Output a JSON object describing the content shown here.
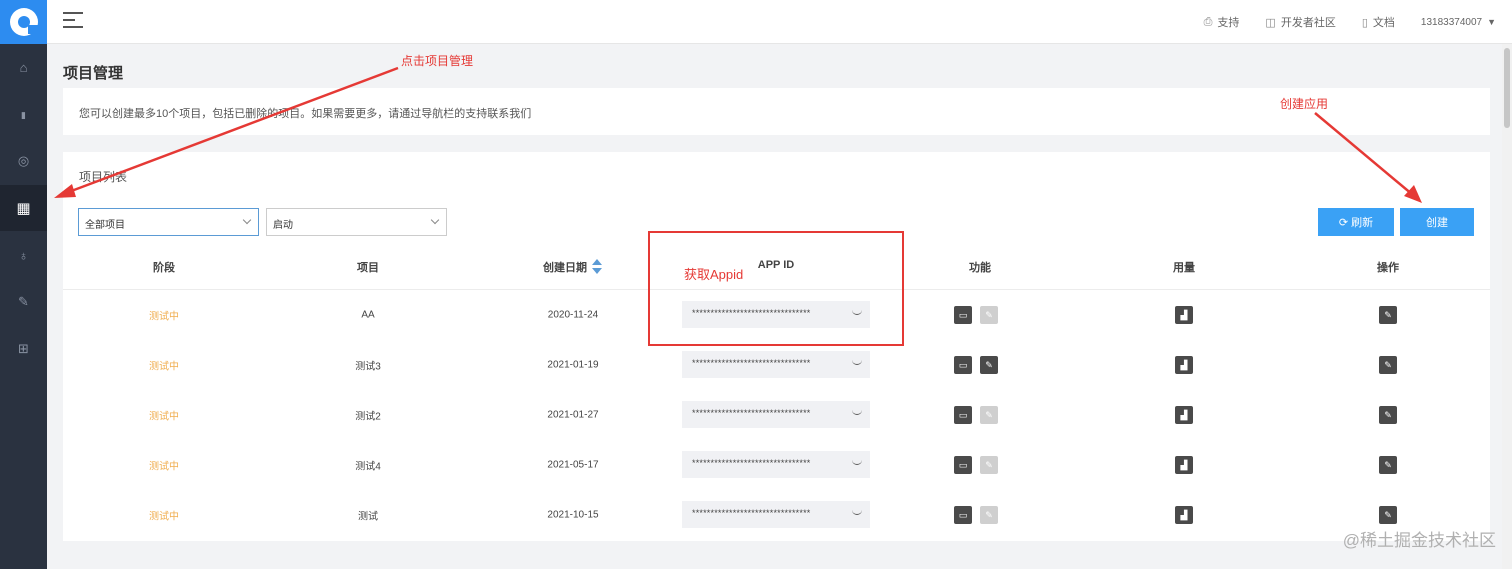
{
  "sidebar": {
    "items": [
      {
        "icon": "home-icon",
        "glyph": "⌂"
      },
      {
        "icon": "bar-chart-icon",
        "glyph": "▮"
      },
      {
        "icon": "monitor-icon",
        "glyph": "◎"
      },
      {
        "icon": "grid-icon",
        "glyph": "▦"
      },
      {
        "icon": "moneybag-icon",
        "glyph": "♁"
      },
      {
        "icon": "wrench-icon",
        "glyph": "✎"
      },
      {
        "icon": "gift-icon",
        "glyph": "⊞"
      }
    ],
    "active_index": 3
  },
  "topbar": {
    "support": "支持",
    "community": "开发者社区",
    "docs": "文档",
    "user": "13183374007"
  },
  "page_title": "项目管理",
  "notice": "您可以创建最多10个项目，包括已删除的项目。如果需要更多，请通过导航栏的支持联系我们",
  "panel_title": "项目列表",
  "filters": {
    "project_select": "全部项目",
    "status_select": "启动"
  },
  "buttons": {
    "refresh": "刷新",
    "create": "创建"
  },
  "table": {
    "headers": [
      "阶段",
      "项目",
      "创建日期",
      "APP ID",
      "功能",
      "用量",
      "操作"
    ],
    "rows": [
      {
        "stage": "测试中",
        "project": "AA",
        "date": "2020-11-24",
        "appid": "********************************",
        "func2_enabled": false
      },
      {
        "stage": "测试中",
        "project": "测试3",
        "date": "2021-01-19",
        "appid": "********************************",
        "func2_enabled": true
      },
      {
        "stage": "测试中",
        "project": "测试2",
        "date": "2021-01-27",
        "appid": "********************************",
        "func2_enabled": false
      },
      {
        "stage": "测试中",
        "project": "测试4",
        "date": "2021-05-17",
        "appid": "********************************",
        "func2_enabled": false
      },
      {
        "stage": "测试中",
        "project": "测试",
        "date": "2021-10-15",
        "appid": "********************************",
        "func2_enabled": false
      }
    ]
  },
  "annotations": {
    "click_project_mgmt": "点击项目管理",
    "create_app": "创建应用",
    "get_appid": "获取Appid"
  },
  "watermark": "@稀土掘金技术社区",
  "colors": {
    "sidebar": "#2a3240",
    "brand": "#2d8cf0",
    "button": "#3aa1f5",
    "stage": "#f0ad4e",
    "annotation": "#e53935"
  }
}
